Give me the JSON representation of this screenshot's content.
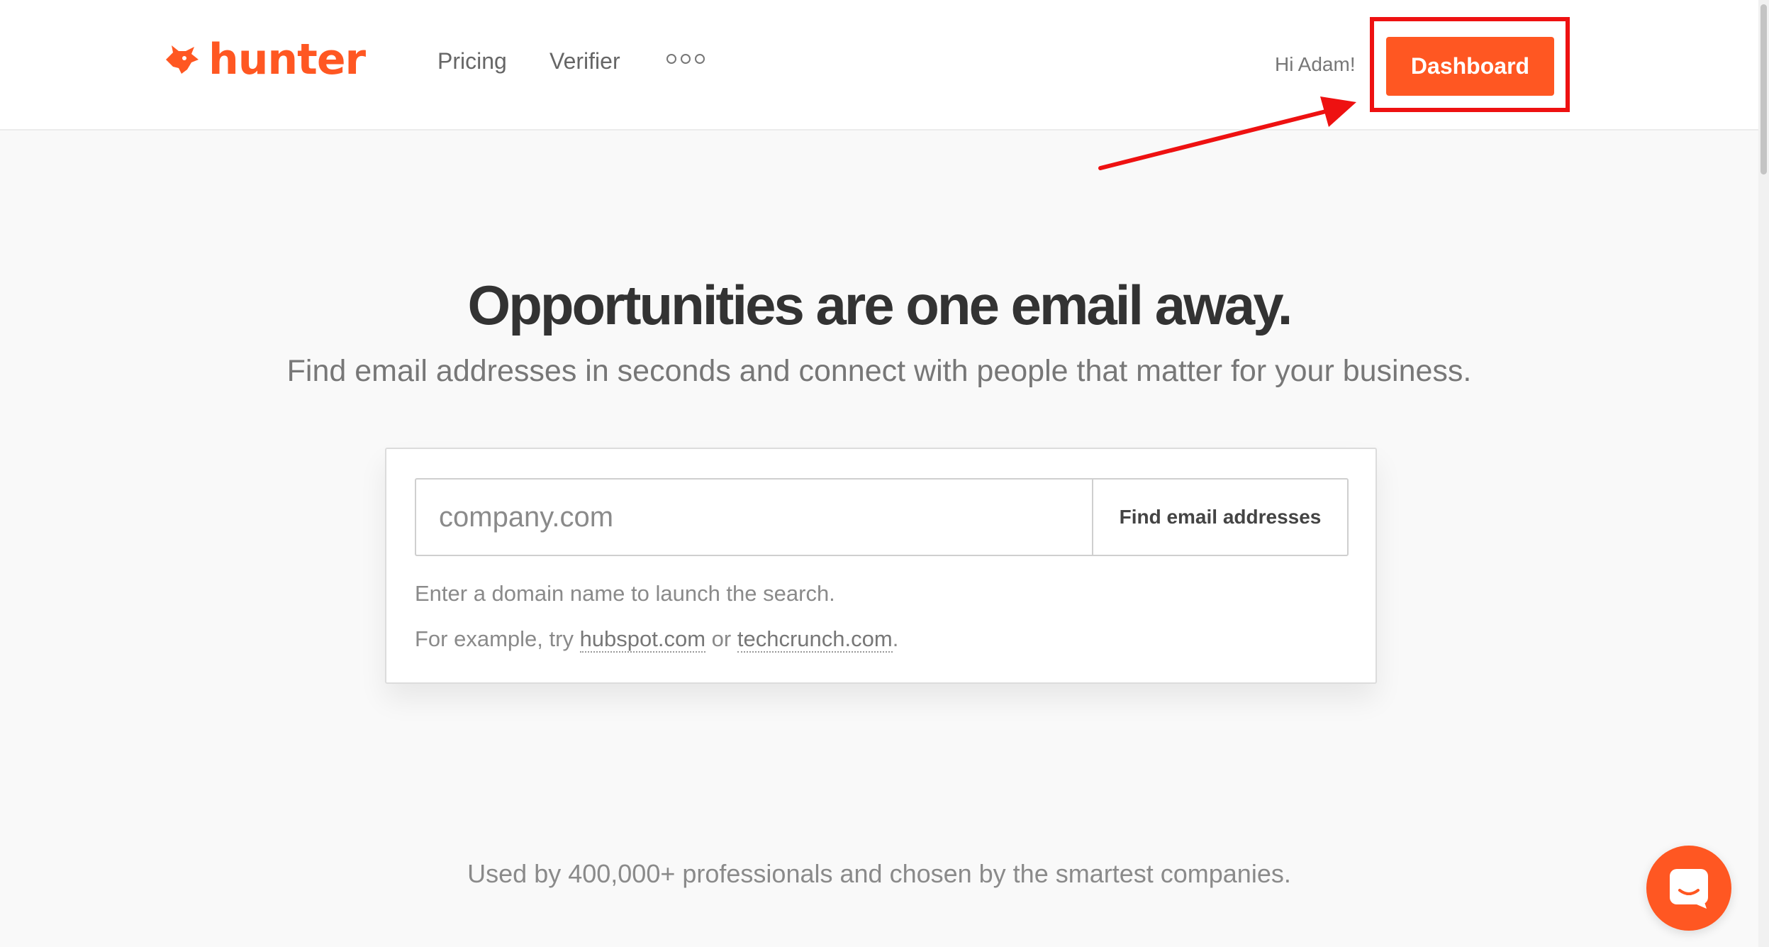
{
  "brand": {
    "name": "hunter",
    "color": "#ff5722",
    "icon": "fox-head-icon"
  },
  "nav": {
    "items": [
      {
        "label": "Pricing"
      },
      {
        "label": "Verifier"
      }
    ],
    "more_icon": "more-dots-icon"
  },
  "user": {
    "greeting": "Hi Adam!",
    "dashboard_label": "Dashboard"
  },
  "hero": {
    "title": "Opportunities are one email away.",
    "subtitle": "Find email addresses in seconds and connect with people that matter for your business."
  },
  "search": {
    "placeholder": "company.com",
    "value": "",
    "button_label": "Find email addresses",
    "hint": "Enter a domain name to launch the search.",
    "example_prefix": "For example, try ",
    "example_1": "hubspot.com",
    "example_sep": " or ",
    "example_2": "techcrunch.com",
    "example_suffix": "."
  },
  "social_proof": "Used by 400,000+ professionals and chosen by the smartest companies.",
  "chat": {
    "icon": "chat-bubble-icon"
  },
  "annotation": {
    "color": "#ee1111"
  }
}
